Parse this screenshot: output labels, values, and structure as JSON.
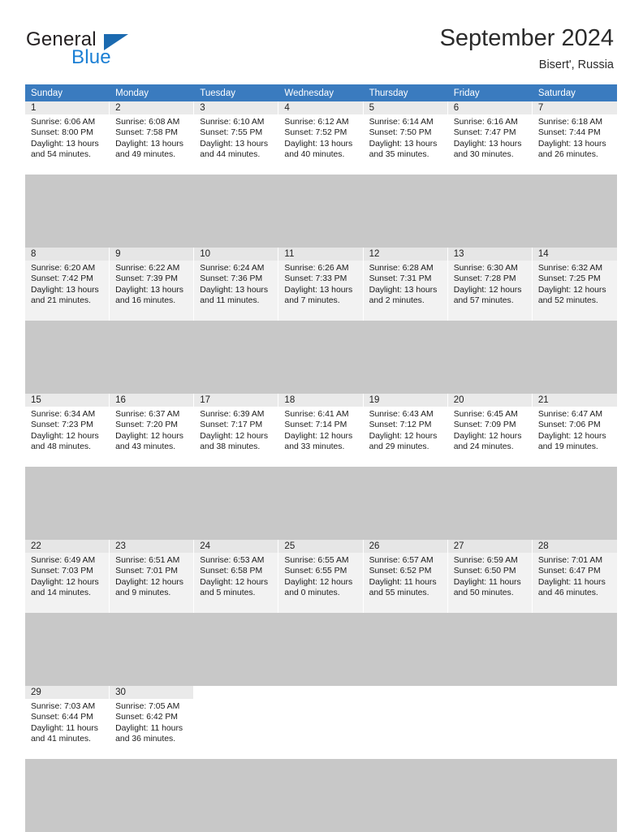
{
  "brand": {
    "name_top": "General",
    "name_bottom": "Blue",
    "triangle_color": "#1b6ab0",
    "blue_color": "#1b7fd4"
  },
  "header": {
    "title": "September 2024",
    "location": "Bisert', Russia"
  },
  "theme": {
    "header_row_bg": "#3a7bbf",
    "header_row_text": "#ffffff",
    "daynum_bg": "#eaeaea",
    "alt_row_bg": "#f2f2f2",
    "grid_line": "#c8c8c8"
  },
  "weekdays": [
    "Sunday",
    "Monday",
    "Tuesday",
    "Wednesday",
    "Thursday",
    "Friday",
    "Saturday"
  ],
  "labels": {
    "sunrise": "Sunrise:",
    "sunset": "Sunset:",
    "daylight": "Daylight:"
  },
  "weeks": [
    [
      {
        "day": "1",
        "sunrise": "Sunrise: 6:06 AM",
        "sunset": "Sunset: 8:00 PM",
        "daylight_1": "Daylight: 13 hours",
        "daylight_2": "and 54 minutes."
      },
      {
        "day": "2",
        "sunrise": "Sunrise: 6:08 AM",
        "sunset": "Sunset: 7:58 PM",
        "daylight_1": "Daylight: 13 hours",
        "daylight_2": "and 49 minutes."
      },
      {
        "day": "3",
        "sunrise": "Sunrise: 6:10 AM",
        "sunset": "Sunset: 7:55 PM",
        "daylight_1": "Daylight: 13 hours",
        "daylight_2": "and 44 minutes."
      },
      {
        "day": "4",
        "sunrise": "Sunrise: 6:12 AM",
        "sunset": "Sunset: 7:52 PM",
        "daylight_1": "Daylight: 13 hours",
        "daylight_2": "and 40 minutes."
      },
      {
        "day": "5",
        "sunrise": "Sunrise: 6:14 AM",
        "sunset": "Sunset: 7:50 PM",
        "daylight_1": "Daylight: 13 hours",
        "daylight_2": "and 35 minutes."
      },
      {
        "day": "6",
        "sunrise": "Sunrise: 6:16 AM",
        "sunset": "Sunset: 7:47 PM",
        "daylight_1": "Daylight: 13 hours",
        "daylight_2": "and 30 minutes."
      },
      {
        "day": "7",
        "sunrise": "Sunrise: 6:18 AM",
        "sunset": "Sunset: 7:44 PM",
        "daylight_1": "Daylight: 13 hours",
        "daylight_2": "and 26 minutes."
      }
    ],
    [
      {
        "day": "8",
        "sunrise": "Sunrise: 6:20 AM",
        "sunset": "Sunset: 7:42 PM",
        "daylight_1": "Daylight: 13 hours",
        "daylight_2": "and 21 minutes."
      },
      {
        "day": "9",
        "sunrise": "Sunrise: 6:22 AM",
        "sunset": "Sunset: 7:39 PM",
        "daylight_1": "Daylight: 13 hours",
        "daylight_2": "and 16 minutes."
      },
      {
        "day": "10",
        "sunrise": "Sunrise: 6:24 AM",
        "sunset": "Sunset: 7:36 PM",
        "daylight_1": "Daylight: 13 hours",
        "daylight_2": "and 11 minutes."
      },
      {
        "day": "11",
        "sunrise": "Sunrise: 6:26 AM",
        "sunset": "Sunset: 7:33 PM",
        "daylight_1": "Daylight: 13 hours",
        "daylight_2": "and 7 minutes."
      },
      {
        "day": "12",
        "sunrise": "Sunrise: 6:28 AM",
        "sunset": "Sunset: 7:31 PM",
        "daylight_1": "Daylight: 13 hours",
        "daylight_2": "and 2 minutes."
      },
      {
        "day": "13",
        "sunrise": "Sunrise: 6:30 AM",
        "sunset": "Sunset: 7:28 PM",
        "daylight_1": "Daylight: 12 hours",
        "daylight_2": "and 57 minutes."
      },
      {
        "day": "14",
        "sunrise": "Sunrise: 6:32 AM",
        "sunset": "Sunset: 7:25 PM",
        "daylight_1": "Daylight: 12 hours",
        "daylight_2": "and 52 minutes."
      }
    ],
    [
      {
        "day": "15",
        "sunrise": "Sunrise: 6:34 AM",
        "sunset": "Sunset: 7:23 PM",
        "daylight_1": "Daylight: 12 hours",
        "daylight_2": "and 48 minutes."
      },
      {
        "day": "16",
        "sunrise": "Sunrise: 6:37 AM",
        "sunset": "Sunset: 7:20 PM",
        "daylight_1": "Daylight: 12 hours",
        "daylight_2": "and 43 minutes."
      },
      {
        "day": "17",
        "sunrise": "Sunrise: 6:39 AM",
        "sunset": "Sunset: 7:17 PM",
        "daylight_1": "Daylight: 12 hours",
        "daylight_2": "and 38 minutes."
      },
      {
        "day": "18",
        "sunrise": "Sunrise: 6:41 AM",
        "sunset": "Sunset: 7:14 PM",
        "daylight_1": "Daylight: 12 hours",
        "daylight_2": "and 33 minutes."
      },
      {
        "day": "19",
        "sunrise": "Sunrise: 6:43 AM",
        "sunset": "Sunset: 7:12 PM",
        "daylight_1": "Daylight: 12 hours",
        "daylight_2": "and 29 minutes."
      },
      {
        "day": "20",
        "sunrise": "Sunrise: 6:45 AM",
        "sunset": "Sunset: 7:09 PM",
        "daylight_1": "Daylight: 12 hours",
        "daylight_2": "and 24 minutes."
      },
      {
        "day": "21",
        "sunrise": "Sunrise: 6:47 AM",
        "sunset": "Sunset: 7:06 PM",
        "daylight_1": "Daylight: 12 hours",
        "daylight_2": "and 19 minutes."
      }
    ],
    [
      {
        "day": "22",
        "sunrise": "Sunrise: 6:49 AM",
        "sunset": "Sunset: 7:03 PM",
        "daylight_1": "Daylight: 12 hours",
        "daylight_2": "and 14 minutes."
      },
      {
        "day": "23",
        "sunrise": "Sunrise: 6:51 AM",
        "sunset": "Sunset: 7:01 PM",
        "daylight_1": "Daylight: 12 hours",
        "daylight_2": "and 9 minutes."
      },
      {
        "day": "24",
        "sunrise": "Sunrise: 6:53 AM",
        "sunset": "Sunset: 6:58 PM",
        "daylight_1": "Daylight: 12 hours",
        "daylight_2": "and 5 minutes."
      },
      {
        "day": "25",
        "sunrise": "Sunrise: 6:55 AM",
        "sunset": "Sunset: 6:55 PM",
        "daylight_1": "Daylight: 12 hours",
        "daylight_2": "and 0 minutes."
      },
      {
        "day": "26",
        "sunrise": "Sunrise: 6:57 AM",
        "sunset": "Sunset: 6:52 PM",
        "daylight_1": "Daylight: 11 hours",
        "daylight_2": "and 55 minutes."
      },
      {
        "day": "27",
        "sunrise": "Sunrise: 6:59 AM",
        "sunset": "Sunset: 6:50 PM",
        "daylight_1": "Daylight: 11 hours",
        "daylight_2": "and 50 minutes."
      },
      {
        "day": "28",
        "sunrise": "Sunrise: 7:01 AM",
        "sunset": "Sunset: 6:47 PM",
        "daylight_1": "Daylight: 11 hours",
        "daylight_2": "and 46 minutes."
      }
    ],
    [
      {
        "day": "29",
        "sunrise": "Sunrise: 7:03 AM",
        "sunset": "Sunset: 6:44 PM",
        "daylight_1": "Daylight: 11 hours",
        "daylight_2": "and 41 minutes."
      },
      {
        "day": "30",
        "sunrise": "Sunrise: 7:05 AM",
        "sunset": "Sunset: 6:42 PM",
        "daylight_1": "Daylight: 11 hours",
        "daylight_2": "and 36 minutes."
      },
      {
        "day": "",
        "sunrise": "",
        "sunset": "",
        "daylight_1": "",
        "daylight_2": ""
      },
      {
        "day": "",
        "sunrise": "",
        "sunset": "",
        "daylight_1": "",
        "daylight_2": ""
      },
      {
        "day": "",
        "sunrise": "",
        "sunset": "",
        "daylight_1": "",
        "daylight_2": ""
      },
      {
        "day": "",
        "sunrise": "",
        "sunset": "",
        "daylight_1": "",
        "daylight_2": ""
      },
      {
        "day": "",
        "sunrise": "",
        "sunset": "",
        "daylight_1": "",
        "daylight_2": ""
      }
    ]
  ]
}
